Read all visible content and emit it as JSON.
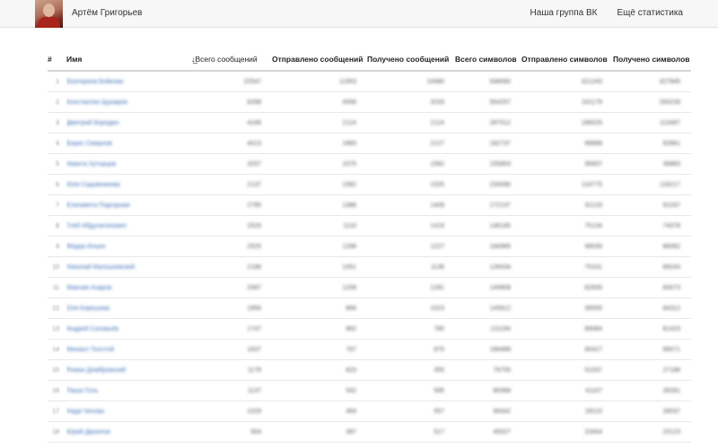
{
  "header": {
    "username": "Артём Григорьев",
    "links": [
      "Наша группа ВК",
      "Ещё статистика"
    ]
  },
  "table": {
    "columns": [
      {
        "label": "#"
      },
      {
        "label": "Имя"
      },
      {
        "label": "Всего сообщений",
        "sorted": true
      },
      {
        "label": "Отправлено сообщений"
      },
      {
        "label": "Получено сообщений"
      },
      {
        "label": "Всего символов"
      },
      {
        "label": "Отправлено символов"
      },
      {
        "label": "Получено символов"
      }
    ],
    "rows": [
      [
        "1",
        "Екатерина Бойкова",
        "22547",
        "11953",
        "10080",
        "938060",
        "321243",
        "427845"
      ],
      [
        "2",
        "Константин Щукарев",
        "8288",
        "4556",
        "3233",
        "554257",
        "241179",
        "293228"
      ],
      [
        "3",
        "Дмитрий Бородин",
        "4248",
        "2124",
        "2124",
        "287512",
        "188025",
        "113487"
      ],
      [
        "4",
        "Борис Смирнов",
        "4013",
        "1883",
        "2127",
        "182737",
        "89888",
        "92861"
      ],
      [
        "5",
        "Никита Хуторцов",
        "3257",
        "1575",
        "1582",
        "155853",
        "95837",
        "39883"
      ],
      [
        "6",
        "Юля Садовникова",
        "2137",
        "1582",
        "1525",
        "233090",
        "116775",
        "116217"
      ],
      [
        "7",
        "Елизавета Подгорная",
        "2795",
        "1386",
        "1409",
        "172137",
        "81133",
        "91037"
      ],
      [
        "8",
        "Глеб Абдулатипович",
        "2529",
        "1110",
        "1419",
        "148185",
        "75134",
        "74078"
      ],
      [
        "9",
        "Фёдор Ильин",
        "2525",
        "1298",
        "1227",
        "184985",
        "99030",
        "86082"
      ],
      [
        "10",
        "Николай Малышевский",
        "2188",
        "1051",
        "1136",
        "128434",
        "75101",
        "89243"
      ],
      [
        "11",
        "Максим Азаров",
        "2087",
        "1208",
        "1281",
        "145808",
        "82835",
        "83073"
      ],
      [
        "12",
        "Оля Корешова",
        "1856",
        "866",
        "1023",
        "145812",
        "39555",
        "84312"
      ],
      [
        "13",
        "Андрей Соловьёв",
        "1747",
        "862",
        "785",
        "131194",
        "89084",
        "81423"
      ],
      [
        "14",
        "Михаил Толстой",
        "1637",
        "797",
        "870",
        "189488",
        "80427",
        "89071"
      ],
      [
        "15",
        "Роман Домбровский",
        "1178",
        "823",
        "355",
        "79755",
        "51037",
        "27188"
      ],
      [
        "16",
        "Паша Голь",
        "1137",
        "542",
        "595",
        "89388",
        "41107",
        "28281"
      ],
      [
        "17",
        "Надя Чехова",
        "1029",
        "469",
        "557",
        "69342",
        "28115",
        "28037"
      ],
      [
        "18",
        "Юрий Данилов",
        "904",
        "387",
        "517",
        "45027",
        "23404",
        "23123"
      ]
    ]
  }
}
